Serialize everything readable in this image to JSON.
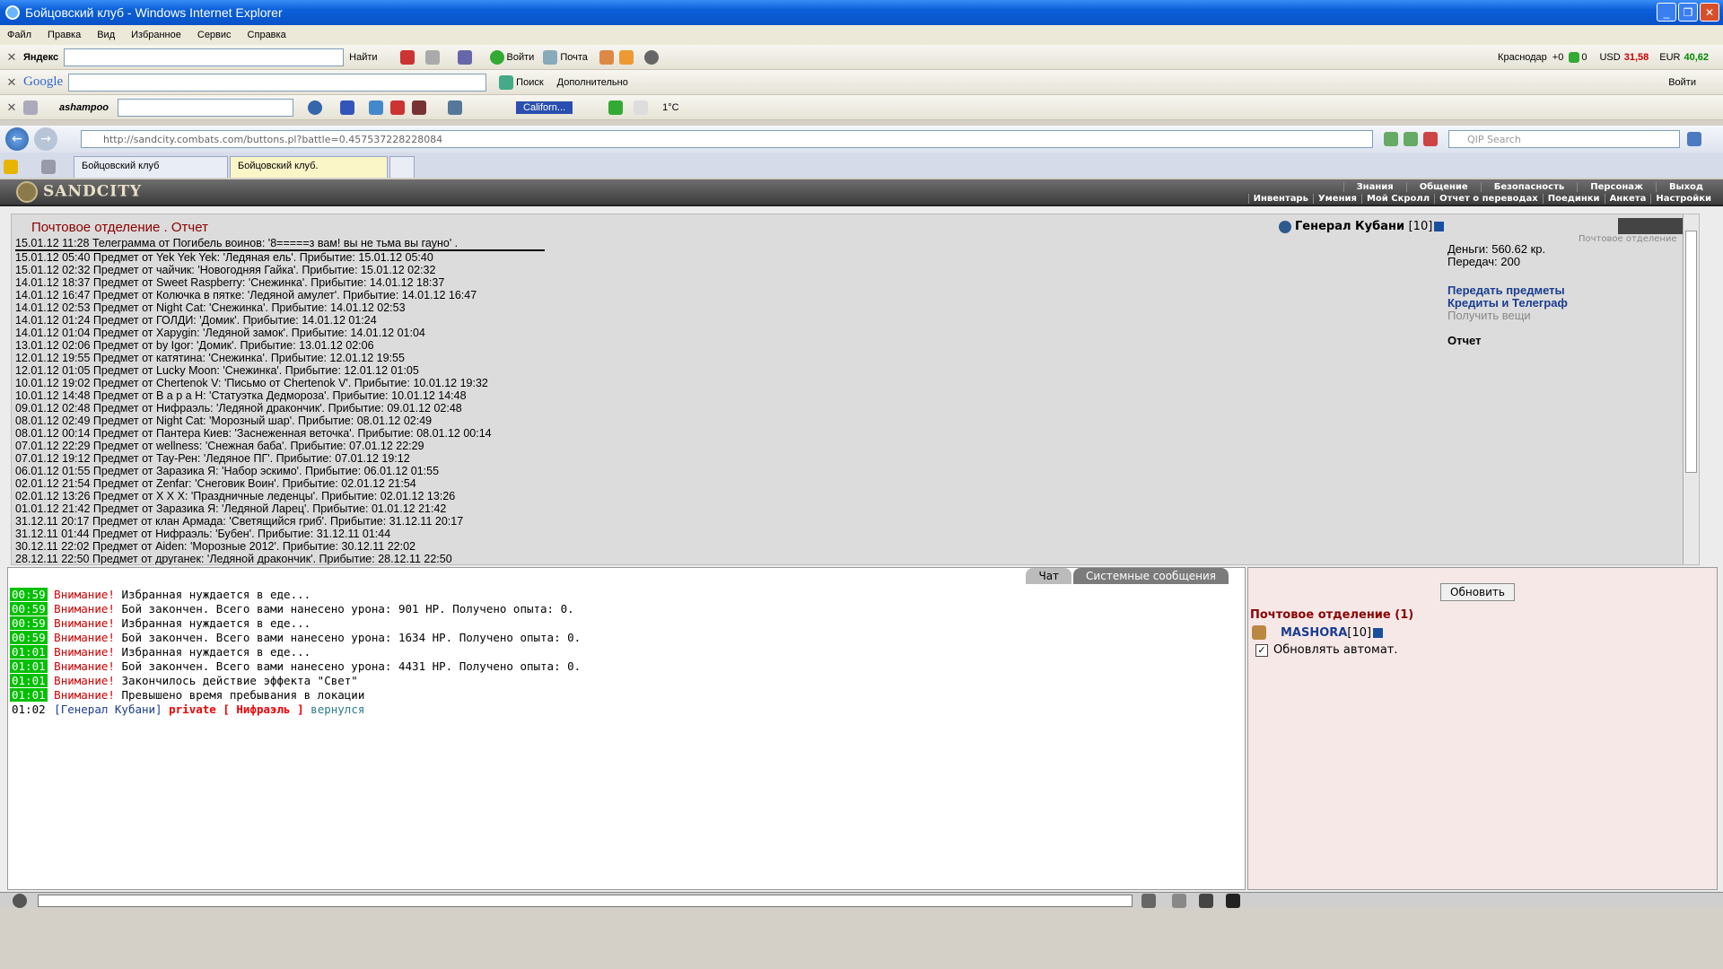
{
  "window": {
    "title": "Бойцовский клуб - Windows Internet Explorer"
  },
  "menu": [
    "Файл",
    "Правка",
    "Вид",
    "Избранное",
    "Сервис",
    "Справка"
  ],
  "yandex_bar": {
    "brand": "Яндекс",
    "find": "Найти",
    "login": "Войти",
    "mail": "Почта",
    "city": "Краснодар",
    "temp_info": "+0",
    "mail_count": "0",
    "usd": "USD",
    "usd_val": "31,58",
    "eur": "EUR",
    "eur_val": "40,62"
  },
  "google_bar": {
    "brand": "Google",
    "search": "Поиск",
    "more": "Дополнительно",
    "login": "Войти"
  },
  "ashampoo_bar": {
    "brand": "ashampoo",
    "station": "Californ...",
    "weather": "1°C"
  },
  "address": {
    "url": "http://sandcity.combats.com/buttons.pl?battle=0.457537228228084",
    "search_placeholder": "QIP Search"
  },
  "tabs": [
    {
      "label": "Бойцовский клуб"
    },
    {
      "label": "Бойцовский клуб."
    }
  ],
  "game": {
    "logo": "SANDCITY",
    "nav_top": [
      "Знания",
      "Общение",
      "Безопасность",
      "Персонаж",
      "Выход"
    ],
    "nav_bottom": [
      "Инвентарь",
      "Умения",
      "Мой Скролл",
      "Отчет о переводах",
      "Поединки",
      "Анкета",
      "Настройки"
    ],
    "mail_title": "Почтовое отделение .  Отчет",
    "player": "Генерал Кубани",
    "player_level": "[10]",
    "back_link": "Почтовое отделение",
    "money": "Деньги: 560.62 кр.",
    "transfers": "Передач: 200",
    "links": [
      "Передать предметы",
      "Кредиты и Телеграф"
    ],
    "disabled_link": "Получить вещи",
    "report": "Отчет",
    "log": [
      "15.01.12 11:28 Телеграмма от Погибель воинов: '8=====з вам! вы не тьма вы гауно' .",
      "15.01.12 05:40 Предмет от Yek Yek Yek: 'Ледяная ель'. Прибытие: 15.01.12 05:40",
      "15.01.12 02:32 Предмет от чайчик: 'Новогодняя Гайка'. Прибытие: 15.01.12 02:32",
      "14.01.12 18:37 Предмет от Sweet Raspberry: 'Снежинка'. Прибытие: 14.01.12 18:37",
      "14.01.12 16:47 Предмет от Колючка в пятке: 'Ледяной амулет'. Прибытие: 14.01.12 16:47",
      "14.01.12 02:53 Предмет от Night Cat: 'Снежинка'. Прибытие: 14.01.12 02:53",
      "14.01.12 01:24 Предмет от ГОЛДИ: 'Домик'. Прибытие: 14.01.12 01:24",
      "14.01.12 01:04 Предмет от Xapygin: 'Ледяной замок'. Прибытие: 14.01.12 01:04",
      "13.01.12 02:06 Предмет от by Igor: 'Домик'. Прибытие: 13.01.12 02:06",
      "12.01.12 19:55 Предмет от катятина: 'Снежинка'. Прибытие: 12.01.12 19:55",
      "12.01.12 01:05 Предмет от Lucky Moon: 'Снежинка'. Прибытие: 12.01.12 01:05",
      "10.01.12 19:02 Предмет от Chertenok V: 'Письмо от Chertenok V'. Прибытие: 10.01.12 19:32",
      "10.01.12 14:48 Предмет от В а р а Н: 'Статуэтка Дедмороза'. Прибытие: 10.01.12 14:48",
      "09.01.12 02:48 Предмет от Нифраэль: 'Ледяной дракончик'. Прибытие: 09.01.12 02:48",
      "08.01.12 02:49 Предмет от Night Cat: 'Морозный шар'. Прибытие: 08.01.12 02:49",
      "08.01.12 00:14 Предмет от Пантера Киев: 'Заснеженная веточка'. Прибытие: 08.01.12 00:14",
      "07.01.12 22:29 Предмет от wellness: 'Снежная баба'. Прибытие: 07.01.12 22:29",
      "07.01.12 19:12 Предмет от Тау-Рен: 'Ледяное ПГ'. Прибытие: 07.01.12 19:12",
      "06.01.12 01:55 Предмет от Заразика Я: 'Набор эскимо'. Прибытие: 06.01.12 01:55",
      "02.01.12 21:54 Предмет от Zenfar: 'Снеговик Воин'. Прибытие: 02.01.12 21:54",
      "02.01.12 13:26 Предмет от X X X: 'Праздничные леденцы'. Прибытие: 02.01.12 13:26",
      "01.01.12 21:42 Предмет от Заразика Я: 'Ледяной Ларец'. Прибытие: 01.01.12 21:42",
      "31.12.11 20:17 Предмет от клан Армада: 'Светящийся гриб'. Прибытие: 31.12.11 20:17",
      "31.12.11 01:44 Предмет от Нифраэль: 'Бубен'. Прибытие: 31.12.11 01:44",
      "30.12.11 22:02 Предмет от Aiden: 'Морозные 2012'. Прибытие: 30.12.11 22:02",
      "28.12.11 22:50 Предмет от друганек: 'Ледяной дракончик'. Прибытие: 28.12.11 22:50"
    ]
  },
  "chat": {
    "tabs": [
      "Чат",
      "Системные сообщения"
    ],
    "lines": [
      {
        "t": "00:59",
        "w": "Внимание!",
        "m": "Избранная нуждается в еде..."
      },
      {
        "t": "00:59",
        "w": "Внимание!",
        "m": "Бой закончен. Всего вами нанесено урона: 901 HP. Получено опыта: 0."
      },
      {
        "t": "00:59",
        "w": "Внимание!",
        "m": "Избранная нуждается в еде..."
      },
      {
        "t": "00:59",
        "w": "Внимание!",
        "m": "Бой закончен. Всего вами нанесено урона: 1634 HP. Получено опыта: 0."
      },
      {
        "t": "01:01",
        "w": "Внимание!",
        "m": "Избранная нуждается в еде..."
      },
      {
        "t": "01:01",
        "w": "Внимание!",
        "m": "Бой закончен. Всего вами нанесено урона: 4431 HP. Получено опыта: 0."
      },
      {
        "t": "01:01",
        "w": "Внимание!",
        "m": "Закончилось действие эффекта \"Свет\""
      },
      {
        "t": "01:01",
        "w": "Внимание!",
        "m": "Превышено время пребывания в локации"
      }
    ],
    "last": {
      "t": "01:02",
      "who": "[Генерал Кубани]",
      "priv": "private [ Нифраэль ]",
      "msg": "вернулся"
    }
  },
  "online": {
    "refresh": "Обновить",
    "location": "Почтовое отделение (1)",
    "user": "MASHORA",
    "user_level": "[10]",
    "auto": "Обновлять автомат."
  }
}
